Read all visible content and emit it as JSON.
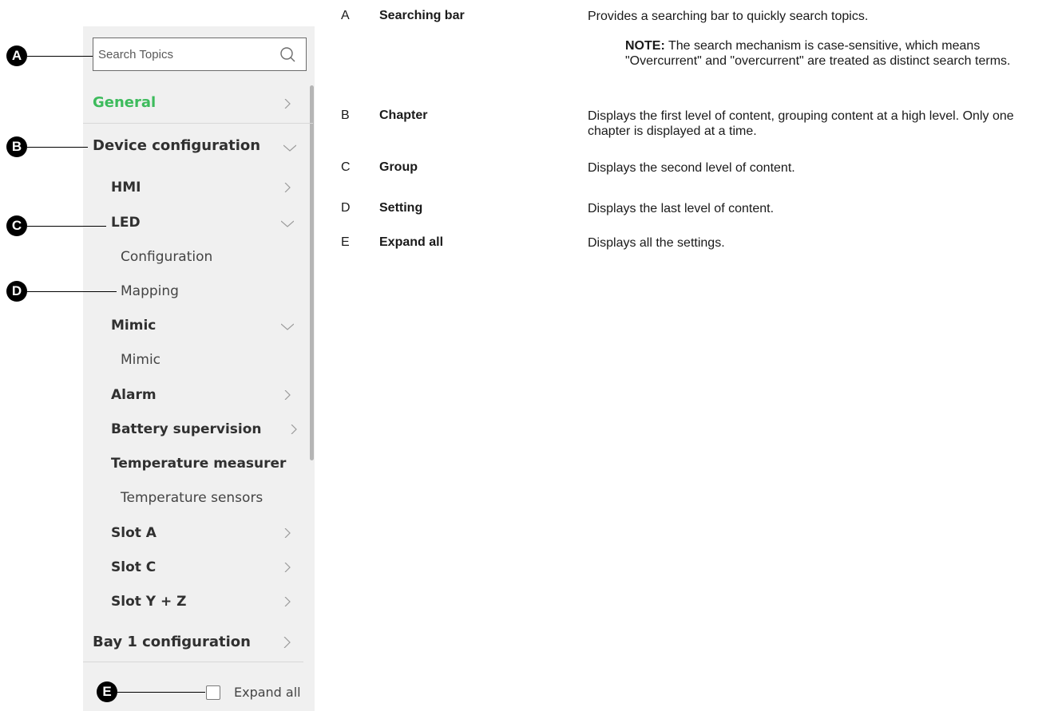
{
  "search": {
    "placeholder": "Search Topics",
    "icon": "search-icon"
  },
  "nav": [
    {
      "id": "general",
      "label": "General",
      "level": 1,
      "chevron": "right",
      "color": "#3dbb5c"
    },
    {
      "id": "device-configuration",
      "label": "Device configuration",
      "level": 1,
      "chevron": "down"
    },
    {
      "id": "hmi",
      "label": "HMI",
      "level": 2,
      "chevron": "right"
    },
    {
      "id": "led",
      "label": "LED",
      "level": 2,
      "chevron": "down"
    },
    {
      "id": "configuration",
      "label": "Configuration",
      "level": 3
    },
    {
      "id": "mapping",
      "label": "Mapping",
      "level": 3
    },
    {
      "id": "mimic-group",
      "label": "Mimic",
      "level": 2,
      "chevron": "down"
    },
    {
      "id": "mimic-setting",
      "label": "Mimic",
      "level": 3
    },
    {
      "id": "alarm",
      "label": "Alarm",
      "level": 2,
      "chevron": "right"
    },
    {
      "id": "battery-supervision",
      "label": "Battery supervision",
      "level": 2,
      "chevron": "right"
    },
    {
      "id": "temperature-measurement",
      "label": "Temperature measurer",
      "level": 2
    },
    {
      "id": "temperature-sensors",
      "label": "Temperature sensors",
      "level": 3
    },
    {
      "id": "slot-a",
      "label": "Slot A",
      "level": 2,
      "chevron": "right"
    },
    {
      "id": "slot-c",
      "label": "Slot C",
      "level": 2,
      "chevron": "right"
    },
    {
      "id": "slot-yz",
      "label": "Slot Y + Z",
      "level": 2,
      "chevron": "right"
    },
    {
      "id": "bay-1-configuration",
      "label": "Bay 1 configuration",
      "level": 1,
      "chevron": "right"
    }
  ],
  "expand_all": {
    "label": "Expand all",
    "checked": false
  },
  "callouts": [
    "A",
    "B",
    "C",
    "D",
    "E"
  ],
  "legend": [
    {
      "letter": "A",
      "term": "Searching bar",
      "description": "Provides a searching bar to quickly search topics.",
      "note": {
        "label": "NOTE:",
        "text": " The search mechanism is case-sensitive, which means \"Overcurrent\" and \"overcurrent\" are treated as distinct search terms."
      }
    },
    {
      "letter": "B",
      "term": "Chapter",
      "description": "Displays the first level of content, grouping content at a high level. Only one chapter is displayed at a time."
    },
    {
      "letter": "C",
      "term": "Group",
      "description": "Displays the second level of content."
    },
    {
      "letter": "D",
      "term": "Setting",
      "description": "Displays the last level of content."
    },
    {
      "letter": "E",
      "term": "Expand all",
      "description": "Displays all the settings."
    }
  ]
}
